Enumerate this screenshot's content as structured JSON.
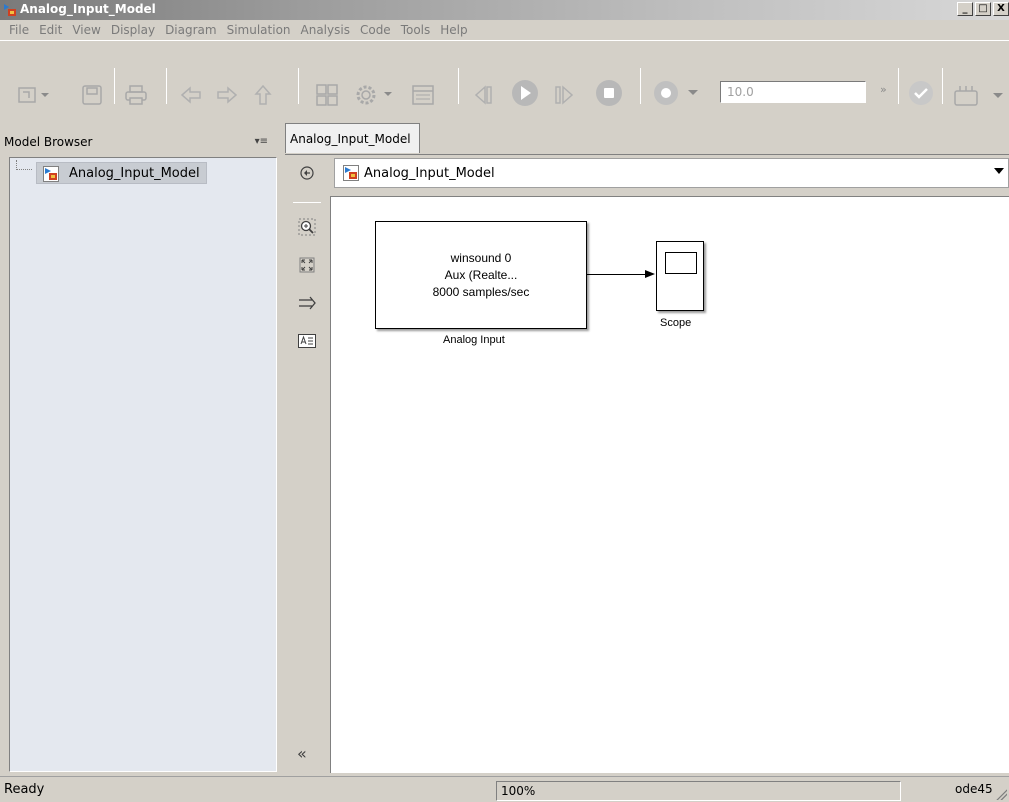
{
  "window": {
    "title": "Analog_Input_Model",
    "controls": {
      "minimize": "_",
      "maximize": "□",
      "close": "X"
    }
  },
  "menu": [
    "File",
    "Edit",
    "View",
    "Display",
    "Diagram",
    "Simulation",
    "Analysis",
    "Code",
    "Tools",
    "Help"
  ],
  "toolbar": {
    "icons": [
      "new-model-icon",
      "save-icon",
      "print-icon",
      "back-icon",
      "forward-icon",
      "up-icon",
      "library-browser-icon",
      "model-config-icon",
      "model-explorer-icon",
      "step-back-icon",
      "run-icon",
      "step-forward-icon",
      "stop-icon",
      "record-icon",
      "check-icon",
      "build-icon"
    ],
    "stop_time": "10.0",
    "more": "»"
  },
  "model_browser": {
    "title": "Model Browser",
    "menu_glyph": "▾≡",
    "tree": [
      {
        "label": "Analog_Input_Model"
      }
    ]
  },
  "tab": {
    "label": "Analog_Input_Model"
  },
  "address": {
    "path": "Analog_Input_Model"
  },
  "vertical_tools": {
    "collapse": "«"
  },
  "diagram": {
    "blocks": [
      {
        "id": "analog-input",
        "lines": [
          "winsound 0",
          "Aux (Realte...",
          "8000 samples/sec"
        ],
        "label": "Analog Input"
      },
      {
        "id": "scope",
        "label": "Scope"
      }
    ]
  },
  "status": {
    "state": "Ready",
    "zoom": "100%",
    "solver": "ode45"
  },
  "colors": {
    "chrome": "#d4d0c8",
    "canvas": "#ffffff",
    "tree_bg": "#e4e8ef"
  }
}
